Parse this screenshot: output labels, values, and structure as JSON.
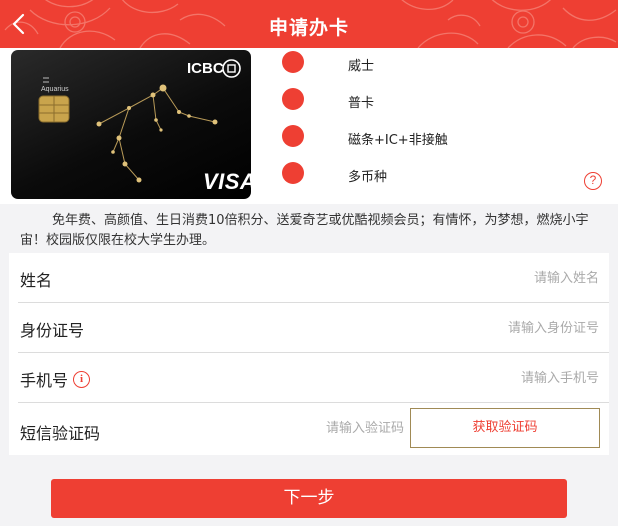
{
  "header": {
    "title": "申请办卡",
    "back_icon": "chevron-left-icon",
    "background": "#ee3f33"
  },
  "card": {
    "brand": "ICBC",
    "network": "VISA",
    "constellation": "Aquarius"
  },
  "features": [
    {
      "label": "威士"
    },
    {
      "label": "普卡"
    },
    {
      "label": "磁条+IC+非接触"
    },
    {
      "label": "多币种"
    }
  ],
  "help_icon_glyph": "?",
  "description": "免年费、高颜值、生日消费10倍积分、送爱奇艺或优酷视频会员；有情怀，为梦想，燃烧小宇宙！校园版仅限在校大学生办理。",
  "form": {
    "name": {
      "label": "姓名",
      "placeholder": "请输入姓名"
    },
    "id_card": {
      "label": "身份证号",
      "placeholder": "请输入身份证号"
    },
    "phone": {
      "label": "手机号",
      "placeholder": "请输入手机号",
      "info_glyph": "i"
    },
    "sms_code": {
      "label": "短信验证码",
      "placeholder": "请输入验证码",
      "button": "获取验证码"
    }
  },
  "next_button": "下一步",
  "colors": {
    "accent": "#ee3f33",
    "button_border": "#a08a55"
  }
}
